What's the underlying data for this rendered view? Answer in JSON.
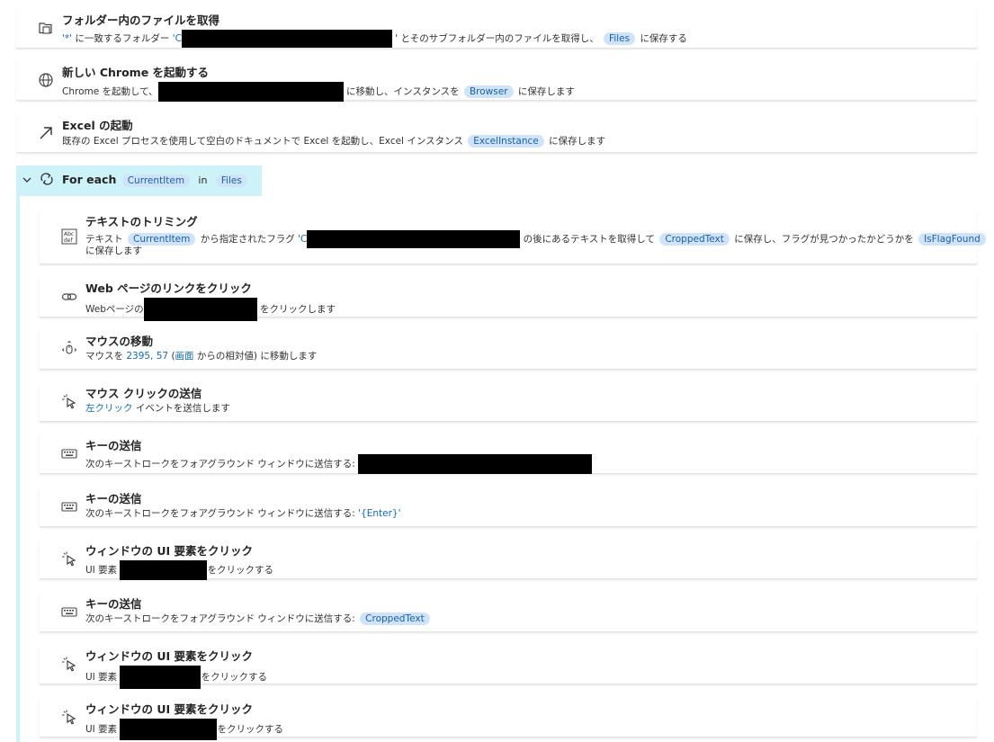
{
  "actions": {
    "get_files": {
      "title": "フォルダー内のファイルを取得",
      "pattern": "'*'",
      "seg1": "に一致するフォルダー",
      "quote_open": "'C",
      "seg2": "' とそのサブフォルダー内のファイルを取得し、",
      "var": "Files",
      "seg3": "に保存する"
    },
    "launch_chrome": {
      "title": "新しい Chrome を起動する",
      "seg1": "Chrome を起動して、",
      "seg2": "に移動し、インスタンスを",
      "var": "Browser",
      "seg3": "に保存します"
    },
    "launch_excel": {
      "title": "Excel の起動",
      "seg1": "既存の Excel プロセスを使用して空白のドキュメントで Excel を起動し、Excel インスタンス",
      "var": "ExcelInstance",
      "seg2": "に保存します"
    },
    "for_each": {
      "label": "For each",
      "item_var": "CurrentItem",
      "in_text": "in",
      "list_var": "Files"
    },
    "trim_text": {
      "title": "テキストのトリミング",
      "seg1": "テキスト",
      "var1": "CurrentItem",
      "seg2": "から指定されたフラグ",
      "quote_open": "'C",
      "seg3": "の後にあるテキストを取得して",
      "var2": "CroppedText",
      "seg4": "に保存し、フラグが見つかったかどうかを",
      "var3": "IsFlagFound",
      "seg5": "に保存します"
    },
    "click_link": {
      "title": "Web ページのリンクをクリック",
      "seg1": "Webページの",
      "seg2": "をクリックします"
    },
    "mouse_move": {
      "title": "マウスの移動",
      "seg1": "マウスを",
      "coords": "2395, 57",
      "paren_open": " (",
      "screen": "画面",
      "seg2": " からの相対値) に移動します"
    },
    "mouse_click": {
      "title": "マウス クリックの送信",
      "link": "左クリック",
      "seg1": " イベントを送信します"
    },
    "send_keys_1": {
      "title": "キーの送信",
      "seg1": "次のキーストロークをフォアグラウンド ウィンドウに送信する:"
    },
    "send_keys_2": {
      "title": "キーの送信",
      "seg1": "次のキーストロークをフォアグラウンド ウィンドウに送信する:",
      "keys": "'{Enter}'"
    },
    "click_ui_1": {
      "title": "ウィンドウの UI 要素をクリック",
      "seg1": "UI 要素",
      "seg2": "をクリックする"
    },
    "send_keys_3": {
      "title": "キーの送信",
      "seg1": "次のキーストロークをフォアグラウンド ウィンドウに送信する:",
      "var": "CroppedText"
    },
    "click_ui_2": {
      "title": "ウィンドウの UI 要素をクリック",
      "seg1": "UI 要素",
      "seg2": "をクリックする"
    },
    "click_ui_3": {
      "title": "ウィンドウの UI 要素をクリック",
      "seg1": "UI 要素",
      "seg2": "をクリックする"
    }
  },
  "colors": {
    "pill_bg": "#cfe4fa",
    "pill_text": "#1b5fa8",
    "link": "#0f6cbd",
    "loop_band": "#cdf3f9",
    "redaction": "#000000"
  },
  "icons": {
    "get_files": "folder-files-icon",
    "launch_chrome": "globe-icon",
    "launch_excel": "arrow-up-right-icon",
    "for_each": "loop-icon",
    "trim_text": "text-abc-icon",
    "click_link": "link-icon",
    "mouse_move": "mouse-move-icon",
    "mouse_click": "cursor-click-icon",
    "send_keys": "keyboard-icon",
    "click_ui": "cursor-click-icon"
  }
}
